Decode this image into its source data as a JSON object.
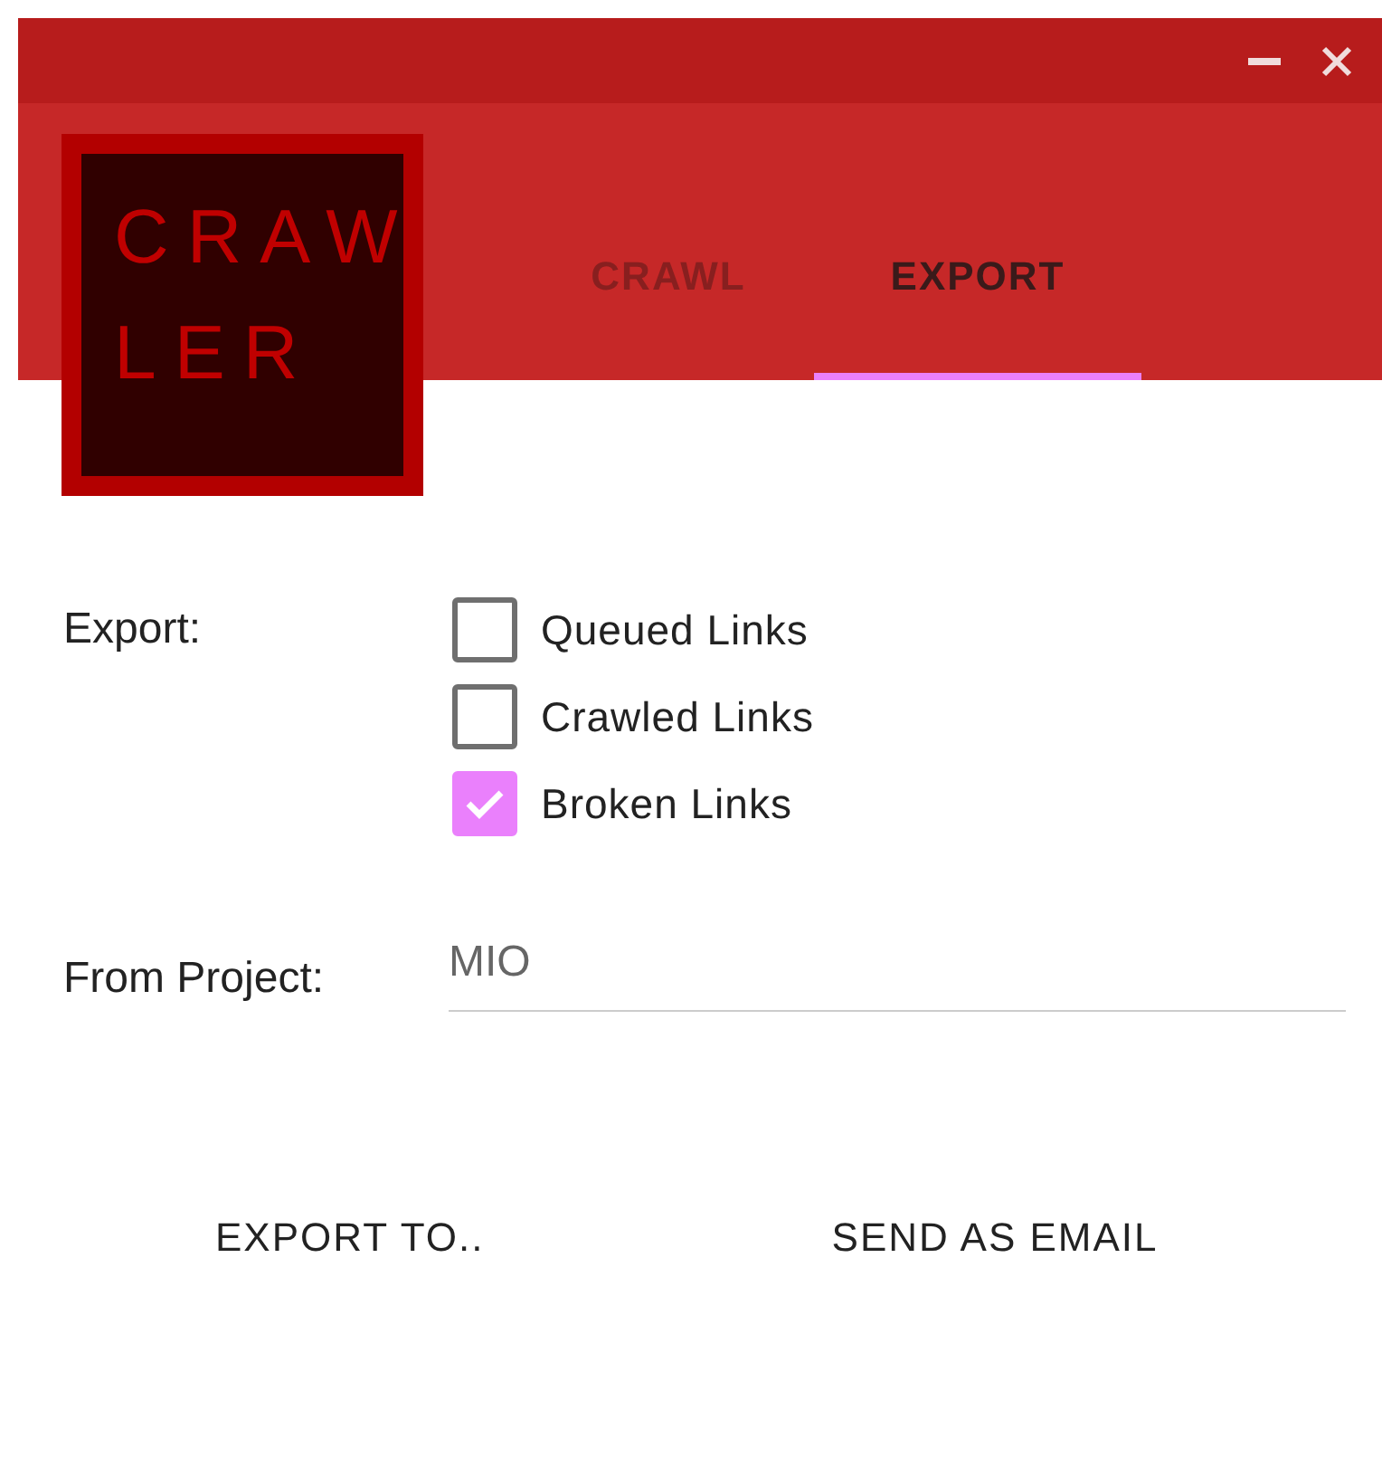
{
  "logo": {
    "lines": [
      "CRAW",
      "LER"
    ]
  },
  "tabs": [
    {
      "label": "CRAWL",
      "selected": false
    },
    {
      "label": "EXPORT",
      "selected": true
    }
  ],
  "export": {
    "label": "Export:",
    "options": [
      {
        "label": "Queued Links",
        "checked": false
      },
      {
        "label": "Crawled Links",
        "checked": false
      },
      {
        "label": "Broken Links",
        "checked": true
      }
    ]
  },
  "project": {
    "label": "From Project:",
    "value": "MIO"
  },
  "buttons": [
    "EXPORT TO..",
    "SEND AS EMAIL"
  ]
}
